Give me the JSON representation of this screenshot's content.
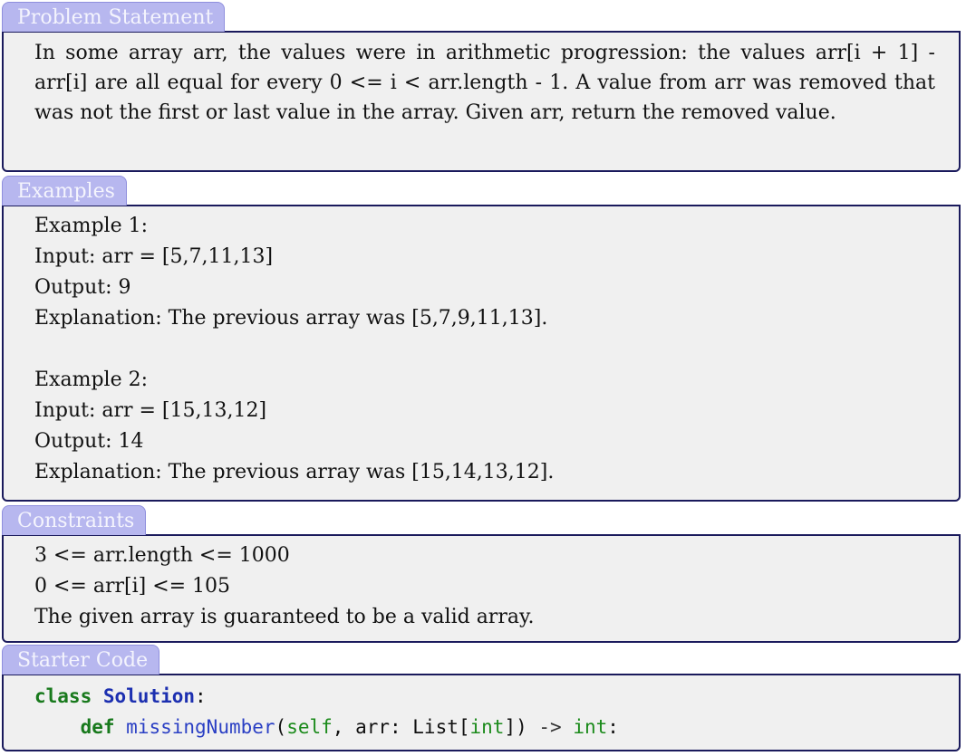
{
  "sections": {
    "problem": {
      "title": "Problem Statement",
      "text": "In some array arr, the values were in arithmetic progression: the values arr[i + 1] - arr[i] are all equal for every 0 <= i < arr.length - 1. A value from arr was removed that was not the first or last value in the array. Given arr, return the removed value."
    },
    "examples": {
      "title": "Examples",
      "lines": [
        "Example 1:",
        "Input: arr = [5,7,11,13]",
        "Output: 9",
        "Explanation: The previous array was [5,7,9,11,13].",
        "",
        "Example 2:",
        "Input: arr = [15,13,12]",
        "Output: 14",
        "Explanation: The previous array was [15,14,13,12]."
      ]
    },
    "constraints": {
      "title": "Constraints",
      "lines": [
        "3 <= arr.length <= 1000",
        "0 <= arr[i] <= 105",
        "The given array is guaranteed to be a valid array."
      ]
    },
    "starter": {
      "title": "Starter Code",
      "code": {
        "kw_class": "class",
        "class_name": "Solution",
        "colon": ":",
        "indent": "    ",
        "kw_def": "def",
        "fn_name": "missingNumber",
        "params_open": "(",
        "param_self": "self",
        "params_mid": ", arr: List[",
        "type_int": "int",
        "params_close": "])",
        "arrow": " -> ",
        "return_type": "int",
        "end_colon": ":"
      }
    }
  },
  "colors": {
    "tab_background": "#b7b7ef",
    "tab_text": "#f4f4fd",
    "box_background": "#f0f0f0",
    "box_border": "#1a1a5c",
    "keyword": "#18791c",
    "class_name": "#1c2fb0",
    "function_name": "#2a3fc4"
  }
}
